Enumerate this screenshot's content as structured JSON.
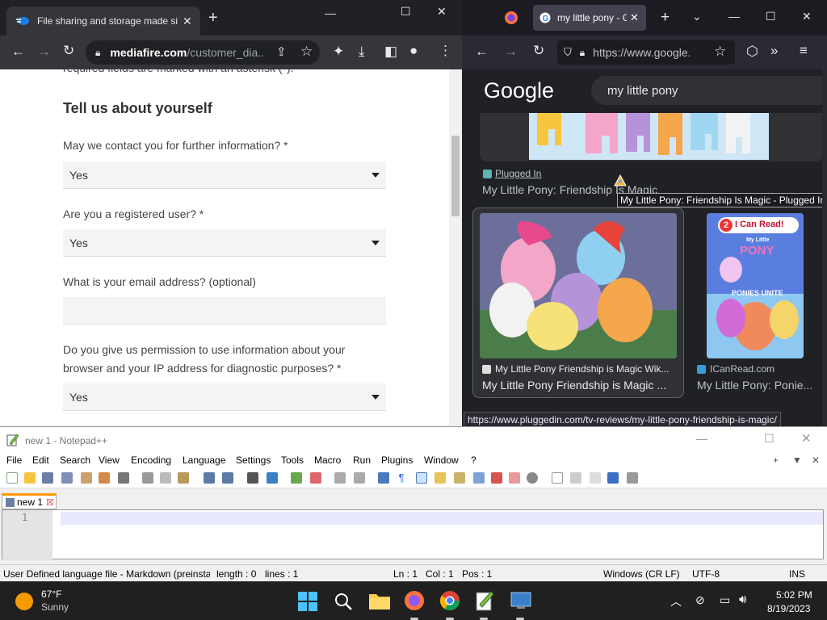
{
  "chrome": {
    "tab_title": "File sharing and storage made si",
    "url_host": "mediafire.com",
    "url_path": "/customer_dia...",
    "form": {
      "partial_top": "required fields are marked with an asterisk (*).",
      "heading": "Tell us about yourself",
      "q1": "May we contact you for further information? *",
      "q1_value": "Yes",
      "q2": "Are you a registered user? *",
      "q2_value": "Yes",
      "q3": "What is your email address? (optional)",
      "q3_value": "",
      "q4": "Do you give us permission to use information about your browser and your IP address for diagnostic purposes? *",
      "q4_value": "Yes"
    }
  },
  "firefox": {
    "tab_title": "my little pony - G",
    "url": "https://www.google.",
    "google_logo": "Google",
    "search_query": "my little pony",
    "result1_source": "Plugged In",
    "result1_title": "My Little Pony: Friendship Is Magic",
    "tooltip": "My Little Pony: Friendship Is Magic - Plugged In",
    "result2_source": "My Little Pony Friendship is Magic Wik...",
    "result2_title": "My Little Pony Friendship is Magic ...",
    "result3_badge": "2",
    "result3_badge_text": "I Can Read!",
    "result3_cover_top": "My Little",
    "result3_cover_logo": "PONY",
    "result3_cover_sub": "PONIES UNITE",
    "result3_source": "ICanRead.com",
    "result3_title": "My Little Pony: Ponie...",
    "status_url": "https://www.pluggedin.com/tv-reviews/my-little-pony-friendship-is-magic/"
  },
  "notepad": {
    "title": "new 1 - Notepad++",
    "menu": [
      "File",
      "Edit",
      "Search",
      "View",
      "Encoding",
      "Language",
      "Settings",
      "Tools",
      "Macro",
      "Run",
      "Plugins",
      "Window",
      "?"
    ],
    "tab_label": "new 1",
    "line_number": "1",
    "status": {
      "lang": "User Defined language file - Markdown (preinstal",
      "length": "length : 0",
      "lines": "lines : 1",
      "ln": "Ln : 1",
      "col": "Col : 1",
      "pos": "Pos : 1",
      "eol": "Windows (CR LF)",
      "encoding": "UTF-8",
      "mode": "INS"
    }
  },
  "taskbar": {
    "temp": "67°F",
    "weather": "Sunny",
    "time": "5:02 PM",
    "date": "8/19/2023"
  }
}
